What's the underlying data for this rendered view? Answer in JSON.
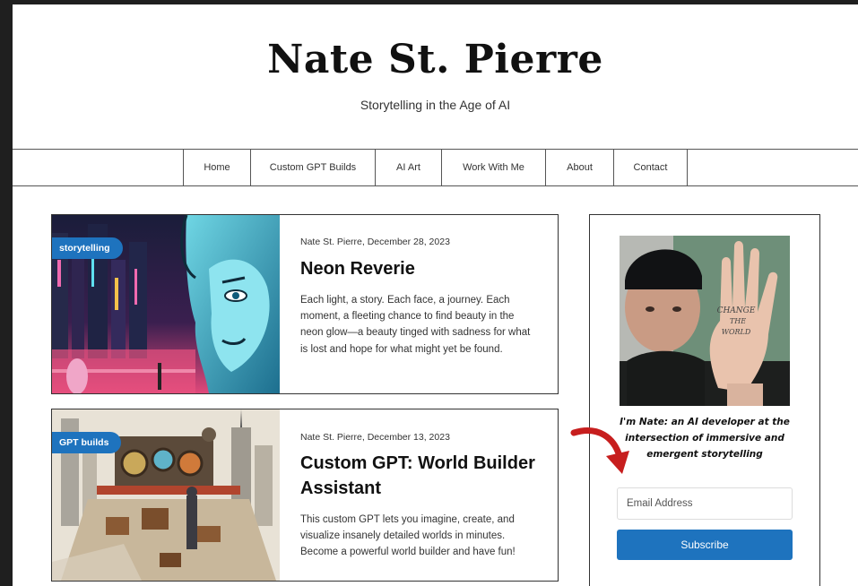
{
  "site": {
    "title": "Nate St. Pierre",
    "tagline": "Storytelling in the Age of AI"
  },
  "nav": {
    "items": [
      "Home",
      "Custom GPT Builds",
      "AI Art",
      "Work With Me",
      "About",
      "Contact"
    ]
  },
  "posts": [
    {
      "tag": "storytelling",
      "meta": "Nate St. Pierre, December 28, 2023",
      "title": "Neon Reverie",
      "excerpt": "Each light, a story. Each face, a journey. Each moment, a fleeting chance to find beauty in the neon glow—a beauty tinged with sadness for what is lost and hope for what might yet be found."
    },
    {
      "tag": "GPT builds",
      "meta": "Nate St. Pierre, December 13, 2023",
      "title": "Custom GPT: World Builder Assistant",
      "excerpt": "This custom GPT lets you imagine, create, and visualize insanely detailed worlds in minutes. Become a powerful world builder and have fun!"
    }
  ],
  "sidebar": {
    "hand_text": [
      "CHANGE",
      "THE",
      "WORLD"
    ],
    "bio": "I'm Nate: an AI developer at the intersection of immersive and emergent storytelling",
    "email_placeholder": "Email Address",
    "subscribe_label": "Subscribe",
    "accent_color": "#1e73be"
  }
}
